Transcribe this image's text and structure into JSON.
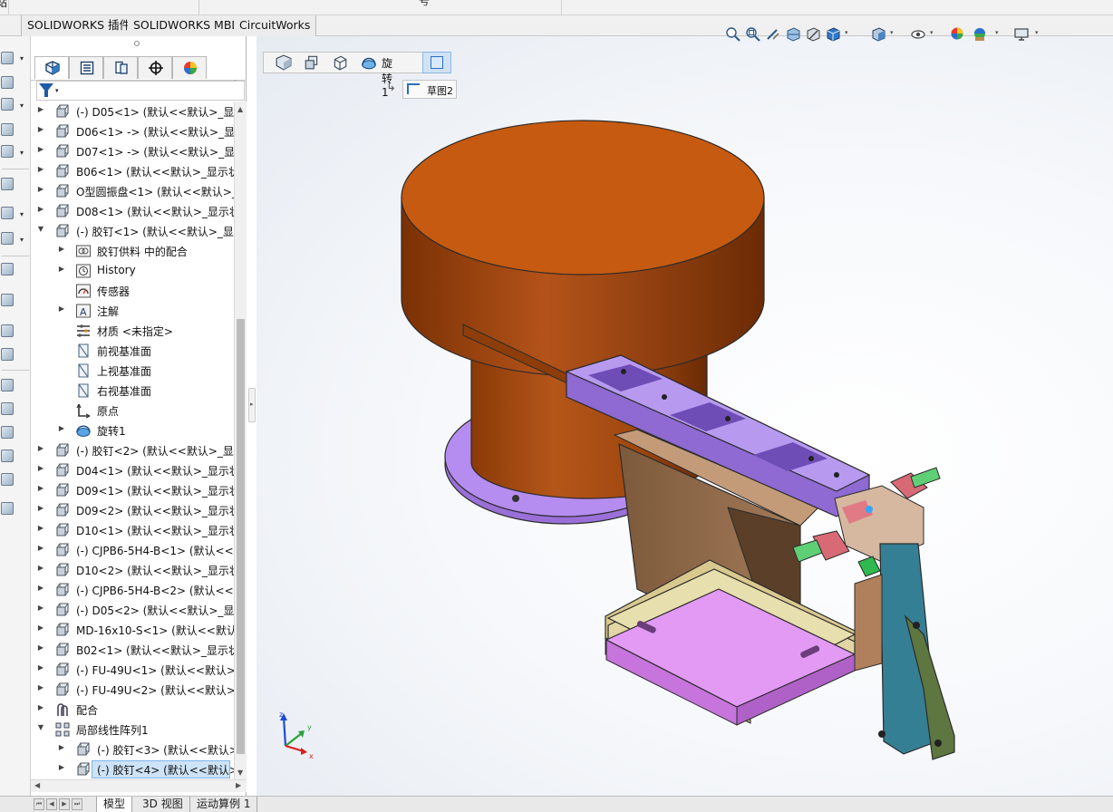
{
  "top": {
    "cut_left": "站",
    "cut_center": "号"
  },
  "command_tabs": [
    "SOLIDWORKS 插件",
    "SOLIDWORKS MBD",
    "CircuitWorks"
  ],
  "feature_tree": {
    "rows": [
      {
        "label": "(-) D05<1> (默认<<默认>_显示",
        "level": 0,
        "expand": "collapsed",
        "icon": "part-icon"
      },
      {
        "label": "D06<1> -> (默认<<默认>_显示",
        "level": 0,
        "expand": "collapsed",
        "icon": "part-icon"
      },
      {
        "label": "D07<1> -> (默认<<默认>_显示",
        "level": 0,
        "expand": "collapsed",
        "icon": "part-icon"
      },
      {
        "label": "B06<1> (默认<<默认>_显示状",
        "level": 0,
        "expand": "collapsed",
        "icon": "part-icon"
      },
      {
        "label": "O型圆振盘<1> (默认<<默认>_",
        "level": 0,
        "expand": "collapsed",
        "icon": "part-icon"
      },
      {
        "label": "D08<1> (默认<<默认>_显示状",
        "level": 0,
        "expand": "collapsed",
        "icon": "part-icon"
      },
      {
        "label": "(-) 胶钉<1> (默认<<默认>_显示",
        "level": 0,
        "expand": "expanded",
        "icon": "part-icon"
      },
      {
        "label": "胶钉供料 中的配合",
        "level": 1,
        "expand": "collapsed",
        "icon": "mates-folder-icon"
      },
      {
        "label": "History",
        "level": 1,
        "expand": "collapsed",
        "icon": "history-icon"
      },
      {
        "label": "传感器",
        "level": 1,
        "expand": "none",
        "icon": "sensor-icon"
      },
      {
        "label": "注解",
        "level": 1,
        "expand": "collapsed",
        "icon": "annotation-icon"
      },
      {
        "label": "材质 <未指定>",
        "level": 1,
        "expand": "none",
        "icon": "material-icon"
      },
      {
        "label": "前视基准面",
        "level": 1,
        "expand": "none",
        "icon": "plane-icon"
      },
      {
        "label": "上视基准面",
        "level": 1,
        "expand": "none",
        "icon": "plane-icon"
      },
      {
        "label": "右视基准面",
        "level": 1,
        "expand": "none",
        "icon": "plane-icon"
      },
      {
        "label": "原点",
        "level": 1,
        "expand": "none",
        "icon": "origin-icon"
      },
      {
        "label": "旋转1",
        "level": 1,
        "expand": "collapsed",
        "icon": "revolve-icon"
      },
      {
        "label": "(-) 胶钉<2> (默认<<默认>_显示",
        "level": 0,
        "expand": "collapsed",
        "icon": "part-icon"
      },
      {
        "label": "D04<1> (默认<<默认>_显示状",
        "level": 0,
        "expand": "collapsed",
        "icon": "part-icon"
      },
      {
        "label": "D09<1> (默认<<默认>_显示状",
        "level": 0,
        "expand": "collapsed",
        "icon": "part-icon"
      },
      {
        "label": "D09<2> (默认<<默认>_显示状",
        "level": 0,
        "expand": "collapsed",
        "icon": "part-icon"
      },
      {
        "label": "D10<1> (默认<<默认>_显示状",
        "level": 0,
        "expand": "collapsed",
        "icon": "part-icon"
      },
      {
        "label": "(-) CJPB6-5H4-B<1> (默认<<默",
        "level": 0,
        "expand": "collapsed",
        "icon": "part-icon"
      },
      {
        "label": "D10<2> (默认<<默认>_显示状",
        "level": 0,
        "expand": "collapsed",
        "icon": "part-icon"
      },
      {
        "label": "(-) CJPB6-5H4-B<2> (默认<<默",
        "level": 0,
        "expand": "collapsed",
        "icon": "part-icon"
      },
      {
        "label": "(-) D05<2> (默认<<默认>_显示",
        "level": 0,
        "expand": "collapsed",
        "icon": "part-icon"
      },
      {
        "label": "MD-16x10-S<1> (默认<<默认",
        "level": 0,
        "expand": "collapsed",
        "icon": "part-icon"
      },
      {
        "label": "B02<1> (默认<<默认>_显示状",
        "level": 0,
        "expand": "collapsed",
        "icon": "part-icon"
      },
      {
        "label": "(-) FU-49U<1> (默认<<默认>_",
        "level": 0,
        "expand": "collapsed",
        "icon": "part-icon"
      },
      {
        "label": "(-) FU-49U<2> (默认<<默认>_",
        "level": 0,
        "expand": "collapsed",
        "icon": "part-icon"
      },
      {
        "label": "配合",
        "level": 0,
        "expand": "collapsed",
        "icon": "mates-icon"
      },
      {
        "label": "局部线性阵列1",
        "level": 0,
        "expand": "expanded",
        "icon": "pattern-icon"
      },
      {
        "label": "(-) 胶钉<3> (默认<<默认>_",
        "level": 1,
        "expand": "collapsed",
        "icon": "part-icon"
      },
      {
        "label": "(-) 胶钉<4> (默认<<默认>_",
        "level": 1,
        "expand": "collapsed",
        "icon": "part-icon",
        "selected": true
      }
    ]
  },
  "bottom_tabs": [
    "模型",
    "3D 视图",
    "运动算例 1"
  ],
  "breadcrumb": {
    "label": "旋转1",
    "sketch_label": "草图2"
  },
  "hud_icons": [
    "zoom-to-fit-icon",
    "zoom-area-icon",
    "previous-view-icon",
    "section-view-icon",
    "dynamic-annotation-icon",
    "view-orientation-icon",
    "display-style-icon",
    "hide-show-icon",
    "edit-appearance-icon",
    "apply-scene-icon",
    "view-settings-icon"
  ],
  "triad": {
    "x": "x",
    "y": "y",
    "z": "z"
  },
  "colors": {
    "selection": "#cde3f7",
    "bowl": "#c65a10",
    "base_plate": "#b58df0",
    "track": "#a786ea"
  }
}
